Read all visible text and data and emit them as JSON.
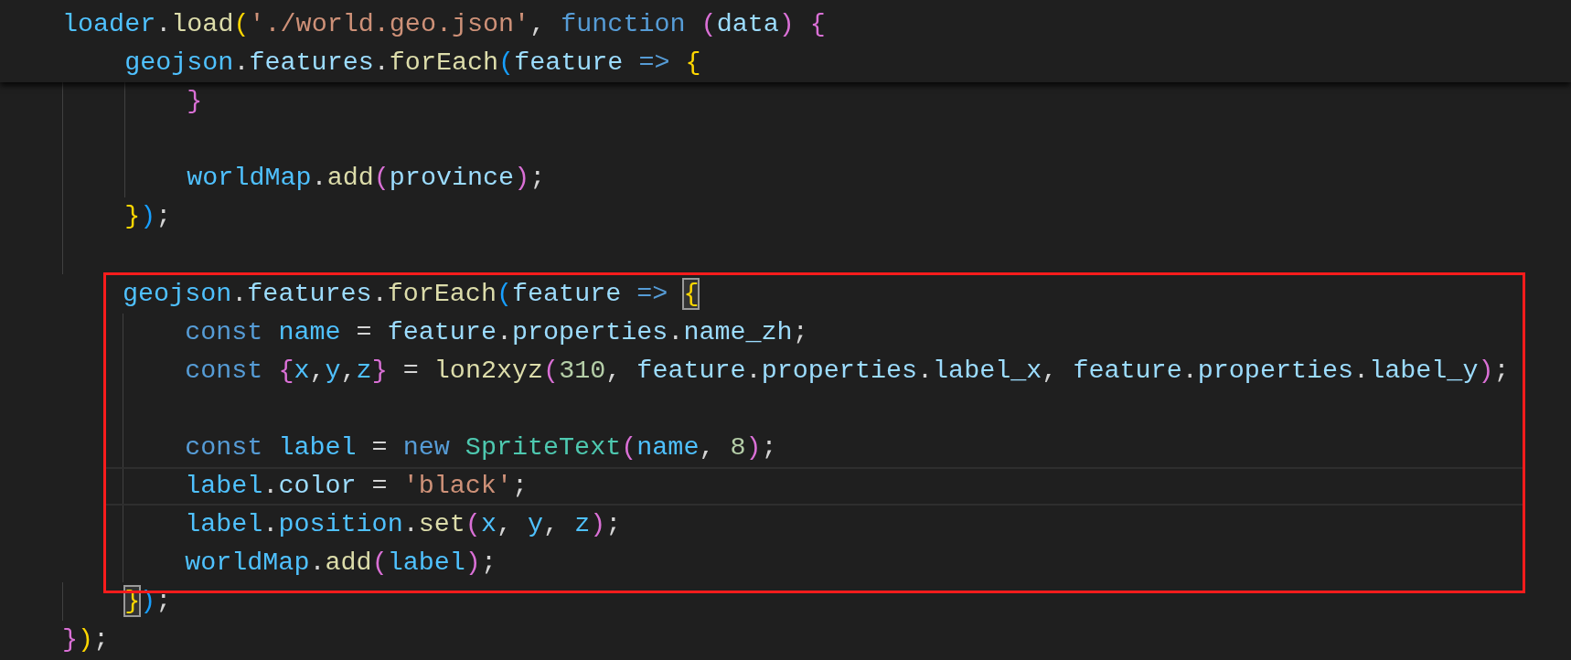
{
  "editor": {
    "lines": [
      {
        "sticky": true,
        "tokens": [
          {
            "text": "loader",
            "kind": "obj"
          },
          {
            "text": ".",
            "kind": "punc"
          },
          {
            "text": "load",
            "kind": "fn"
          },
          {
            "text": "(",
            "kind": "br1"
          },
          {
            "text": "'./world.geo.json'",
            "kind": "str"
          },
          {
            "text": ", ",
            "kind": "punc"
          },
          {
            "text": "function ",
            "kind": "kw"
          },
          {
            "text": "(",
            "kind": "br2"
          },
          {
            "text": "data",
            "kind": "var"
          },
          {
            "text": ") ",
            "kind": "br2"
          },
          {
            "text": "{",
            "kind": "br2"
          }
        ],
        "children": [
          {
            "sticky": true,
            "tokens": [
              {
                "text": "geojson",
                "kind": "obj"
              },
              {
                "text": ".",
                "kind": "punc"
              },
              {
                "text": "features",
                "kind": "var"
              },
              {
                "text": ".",
                "kind": "punc"
              },
              {
                "text": "forEach",
                "kind": "fn"
              },
              {
                "text": "(",
                "kind": "br3"
              },
              {
                "text": "feature ",
                "kind": "var"
              },
              {
                "text": "=> ",
                "kind": "kw"
              },
              {
                "text": "{",
                "kind": "br1"
              }
            ],
            "children": [
              {
                "tokens": [
                  {
                    "text": "}",
                    "kind": "br2"
                  }
                ]
              },
              {
                "blank": true
              },
              {
                "tokens": [
                  {
                    "text": "worldMap",
                    "kind": "obj"
                  },
                  {
                    "text": ".",
                    "kind": "punc"
                  },
                  {
                    "text": "add",
                    "kind": "fn"
                  },
                  {
                    "text": "(",
                    "kind": "br2"
                  },
                  {
                    "text": "province",
                    "kind": "var"
                  },
                  {
                    "text": ")",
                    "kind": "br2"
                  },
                  {
                    "text": ";",
                    "kind": "punc"
                  }
                ]
              }
            ]
          },
          {
            "tokens": [
              {
                "text": "}",
                "kind": "br1"
              },
              {
                "text": ")",
                "kind": "br3"
              },
              {
                "text": ";",
                "kind": "punc"
              }
            ]
          },
          {
            "blank": true
          },
          {
            "highlighted": true,
            "tokens": [
              {
                "text": "geojson",
                "kind": "obj"
              },
              {
                "text": ".",
                "kind": "punc"
              },
              {
                "text": "features",
                "kind": "var"
              },
              {
                "text": ".",
                "kind": "punc"
              },
              {
                "text": "forEach",
                "kind": "fn"
              },
              {
                "text": "(",
                "kind": "br3"
              },
              {
                "text": "feature ",
                "kind": "var"
              },
              {
                "text": "=> ",
                "kind": "kw"
              },
              {
                "text": "{",
                "kind": "br1",
                "matched": true
              }
            ],
            "children": [
              {
                "tokens": [
                  {
                    "text": "const ",
                    "kind": "kw"
                  },
                  {
                    "text": "name",
                    "kind": "obj"
                  },
                  {
                    "text": " = ",
                    "kind": "punc"
                  },
                  {
                    "text": "feature",
                    "kind": "var"
                  },
                  {
                    "text": ".",
                    "kind": "punc"
                  },
                  {
                    "text": "properties",
                    "kind": "var"
                  },
                  {
                    "text": ".",
                    "kind": "punc"
                  },
                  {
                    "text": "name_zh",
                    "kind": "var"
                  },
                  {
                    "text": ";",
                    "kind": "punc"
                  }
                ]
              },
              {
                "tokens": [
                  {
                    "text": "const ",
                    "kind": "kw"
                  },
                  {
                    "text": "{",
                    "kind": "br2"
                  },
                  {
                    "text": "x",
                    "kind": "obj"
                  },
                  {
                    "text": ",",
                    "kind": "punc"
                  },
                  {
                    "text": "y",
                    "kind": "obj"
                  },
                  {
                    "text": ",",
                    "kind": "punc"
                  },
                  {
                    "text": "z",
                    "kind": "obj"
                  },
                  {
                    "text": "}",
                    "kind": "br2"
                  },
                  {
                    "text": " = ",
                    "kind": "punc"
                  },
                  {
                    "text": "lon2xyz",
                    "kind": "fn"
                  },
                  {
                    "text": "(",
                    "kind": "br2"
                  },
                  {
                    "text": "310",
                    "kind": "num"
                  },
                  {
                    "text": ", ",
                    "kind": "punc"
                  },
                  {
                    "text": "feature",
                    "kind": "var"
                  },
                  {
                    "text": ".",
                    "kind": "punc"
                  },
                  {
                    "text": "properties",
                    "kind": "var"
                  },
                  {
                    "text": ".",
                    "kind": "punc"
                  },
                  {
                    "text": "label_x",
                    "kind": "var"
                  },
                  {
                    "text": ", ",
                    "kind": "punc"
                  },
                  {
                    "text": "feature",
                    "kind": "var"
                  },
                  {
                    "text": ".",
                    "kind": "punc"
                  },
                  {
                    "text": "properties",
                    "kind": "var"
                  },
                  {
                    "text": ".",
                    "kind": "punc"
                  },
                  {
                    "text": "label_y",
                    "kind": "var"
                  },
                  {
                    "text": ")",
                    "kind": "br2"
                  },
                  {
                    "text": ";",
                    "kind": "punc"
                  }
                ]
              },
              {
                "blank": true
              },
              {
                "tokens": [
                  {
                    "text": "const ",
                    "kind": "kw"
                  },
                  {
                    "text": "label",
                    "kind": "obj"
                  },
                  {
                    "text": " = ",
                    "kind": "punc"
                  },
                  {
                    "text": "new ",
                    "kind": "kw"
                  },
                  {
                    "text": "SpriteText",
                    "kind": "cls"
                  },
                  {
                    "text": "(",
                    "kind": "br2"
                  },
                  {
                    "text": "name",
                    "kind": "obj"
                  },
                  {
                    "text": ", ",
                    "kind": "punc"
                  },
                  {
                    "text": "8",
                    "kind": "num"
                  },
                  {
                    "text": ")",
                    "kind": "br2"
                  },
                  {
                    "text": ";",
                    "kind": "punc"
                  }
                ]
              },
              {
                "current": true,
                "tokens": [
                  {
                    "text": "label",
                    "kind": "obj"
                  },
                  {
                    "text": ".",
                    "kind": "punc"
                  },
                  {
                    "text": "color",
                    "kind": "var"
                  },
                  {
                    "text": " = ",
                    "kind": "punc"
                  },
                  {
                    "text": "'black'",
                    "kind": "str"
                  },
                  {
                    "text": ";",
                    "kind": "punc"
                  }
                ]
              },
              {
                "tokens": [
                  {
                    "text": "label",
                    "kind": "obj"
                  },
                  {
                    "text": ".",
                    "kind": "punc"
                  },
                  {
                    "text": "position",
                    "kind": "obj"
                  },
                  {
                    "text": ".",
                    "kind": "punc"
                  },
                  {
                    "text": "set",
                    "kind": "fn"
                  },
                  {
                    "text": "(",
                    "kind": "br2"
                  },
                  {
                    "text": "x",
                    "kind": "obj"
                  },
                  {
                    "text": ", ",
                    "kind": "punc"
                  },
                  {
                    "text": "y",
                    "kind": "obj"
                  },
                  {
                    "text": ", ",
                    "kind": "punc"
                  },
                  {
                    "text": "z",
                    "kind": "obj"
                  },
                  {
                    "text": ")",
                    "kind": "br2"
                  },
                  {
                    "text": ";",
                    "kind": "punc"
                  }
                ]
              },
              {
                "tokens": [
                  {
                    "text": "worldMap",
                    "kind": "obj"
                  },
                  {
                    "text": ".",
                    "kind": "punc"
                  },
                  {
                    "text": "add",
                    "kind": "fn"
                  },
                  {
                    "text": "(",
                    "kind": "br2"
                  },
                  {
                    "text": "label",
                    "kind": "obj"
                  },
                  {
                    "text": ")",
                    "kind": "br2"
                  },
                  {
                    "text": ";",
                    "kind": "punc"
                  }
                ]
              }
            ]
          },
          {
            "tokens": [
              {
                "text": "}",
                "kind": "br1",
                "matched": true
              },
              {
                "text": ")",
                "kind": "br3"
              },
              {
                "text": ";",
                "kind": "punc"
              }
            ]
          }
        ]
      },
      {
        "tokens": [
          {
            "text": "}",
            "kind": "br2"
          },
          {
            "text": ")",
            "kind": "br1"
          },
          {
            "text": ";",
            "kind": "punc"
          }
        ]
      }
    ]
  }
}
